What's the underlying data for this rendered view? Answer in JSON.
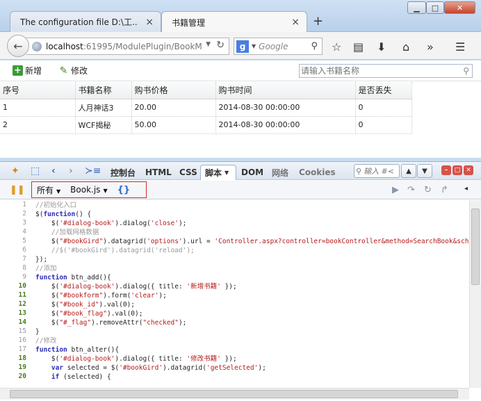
{
  "browser": {
    "tabs": [
      {
        "title": "The configuration file D:\\工..."
      },
      {
        "title": "书籍管理"
      }
    ],
    "url_host": "localhost",
    "url_path": ":61995/ModulePlugin/BookM",
    "search_engine": "Google"
  },
  "page": {
    "toolbar": {
      "add_label": "新增",
      "edit_label": "修改",
      "search_placeholder": "请输入书籍名称"
    },
    "columns": [
      "序号",
      "书籍名称",
      "购书价格",
      "购书时间",
      "是否丢失"
    ],
    "rows": [
      [
        "1",
        "人月神话3",
        "20.00",
        "2014-08-30 00:00:00",
        "0"
      ],
      [
        "2",
        "WCF揭秘",
        "50.00",
        "2014-08-30 00:00:00",
        "0"
      ]
    ]
  },
  "firebug": {
    "tabs": {
      "console": "控制台",
      "html": "HTML",
      "css": "CSS",
      "script": "脚本",
      "dom": "DOM",
      "net": "网络",
      "cookies": "Cookies"
    },
    "search_placeholder": "输入 #<",
    "script_filter": "所有",
    "script_file": "Book.js",
    "pretty_print": "{}"
  },
  "code_lines": [
    {
      "n": "1",
      "text": "//初始化入口"
    },
    {
      "n": "2",
      "text": "$(function() {"
    },
    {
      "n": "3",
      "text": "    $('#dialog-book').dialog('close');"
    },
    {
      "n": "4",
      "text": "    //加载网格数据"
    },
    {
      "n": "5",
      "text": "    $(\"#bookGird\").datagrid('options').url = 'Controller.aspx?controller=bookController&method=SearchBook&schar='"
    },
    {
      "n": "6",
      "text": "    //$('#bookGird').datagrid('reload');"
    },
    {
      "n": "7",
      "text": "});"
    },
    {
      "n": "8",
      "text": "//添加"
    },
    {
      "n": "9",
      "text": "function btn_add(){"
    },
    {
      "n": "10",
      "text": "    $('#dialog-book').dialog({ title: '新增书籍' });"
    },
    {
      "n": "11",
      "text": "    $(\"#bookform\").form('clear');"
    },
    {
      "n": "12",
      "text": "    $(\"#book_id\").val(0);"
    },
    {
      "n": "13",
      "text": "    $(\"#book_flag\").val(0);"
    },
    {
      "n": "14",
      "text": "    $(\"#_flag\").removeAttr(\"checked\");"
    },
    {
      "n": "15",
      "text": "}"
    },
    {
      "n": "16",
      "text": "//修改"
    },
    {
      "n": "17",
      "text": "function btn_alter(){"
    },
    {
      "n": "18",
      "text": "    $('#dialog-book').dialog({ title: '修改书籍' });"
    },
    {
      "n": "19",
      "text": "    var selected = $('#bookGird').datagrid('getSelected');"
    },
    {
      "n": "20",
      "text": "    if (selected) {"
    }
  ]
}
